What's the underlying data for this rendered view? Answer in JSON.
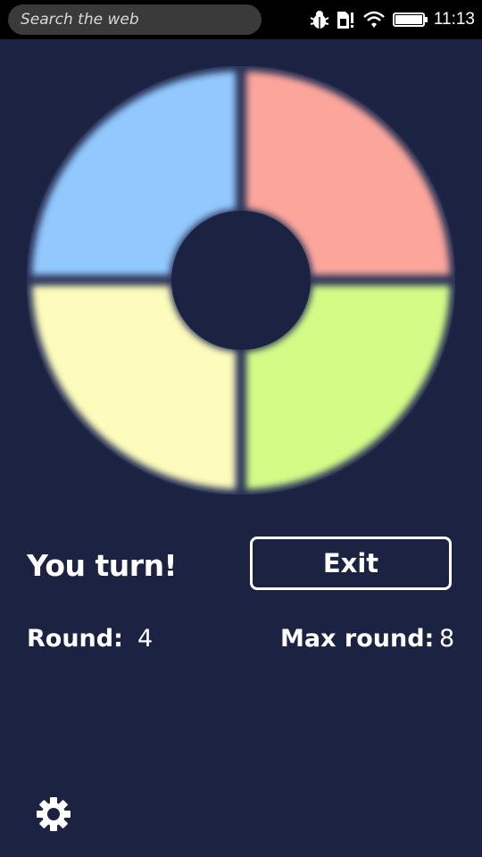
{
  "statusbar": {
    "search_placeholder": "Search the web",
    "time": "11:13",
    "icons": [
      "bug-icon",
      "sim-alert-icon",
      "wifi-icon",
      "battery-icon"
    ]
  },
  "game": {
    "pads": [
      {
        "name": "blue-pad",
        "color": "#92c8fd"
      },
      {
        "name": "red-pad",
        "color": "#fca69b"
      },
      {
        "name": "yellow-pad",
        "color": "#fdfcbc"
      },
      {
        "name": "green-pad",
        "color": "#d3fb86"
      }
    ],
    "turn_message": "You turn!",
    "exit_label": "Exit",
    "round_label": "Round:",
    "round_value": "4",
    "max_round_label": "Max round:",
    "max_round_value": "8"
  },
  "colors": {
    "background": "#1b2242",
    "text": "#ffffff"
  },
  "footer": {
    "settings_icon": "gear-icon"
  }
}
